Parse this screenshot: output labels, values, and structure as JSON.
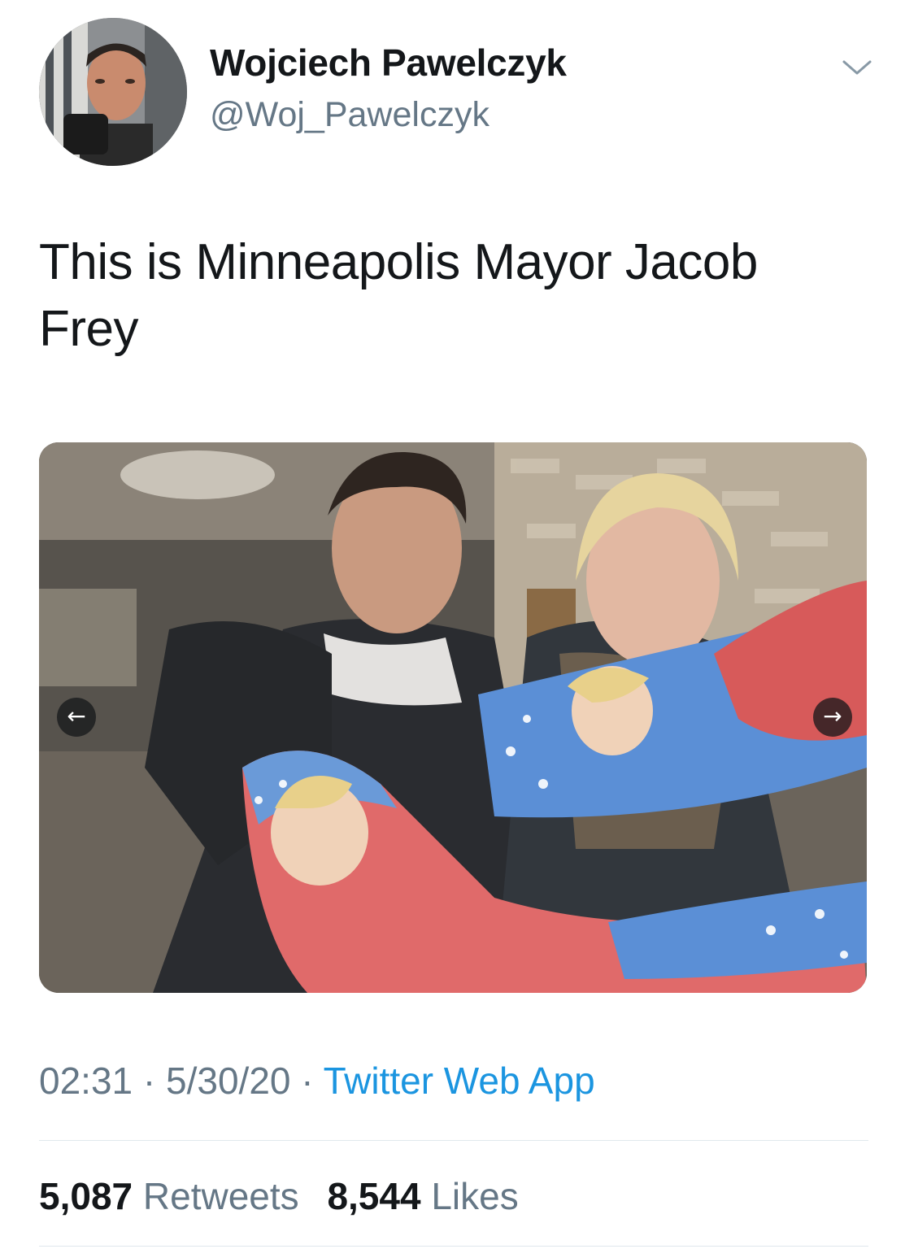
{
  "author": {
    "display_name": "Wojciech Pawelczyk",
    "handle": "@Woj_Pawelczyk",
    "avatar_icon": "profile-photo"
  },
  "menu": {
    "icon": "chevron-down-icon"
  },
  "tweet": {
    "text": "This is Minneapolis Mayor Jacob Frey"
  },
  "media": {
    "prev_icon": "←",
    "next_icon": "→"
  },
  "meta": {
    "time": "02:31",
    "separator": "·",
    "date": "5/30/20",
    "source": "Twitter Web App"
  },
  "stats": {
    "retweets_count": "5,087",
    "retweets_label": "Retweets",
    "likes_count": "8,544",
    "likes_label": "Likes"
  },
  "colors": {
    "text": "#14171a",
    "secondary": "#657786",
    "link": "#1b95e0",
    "divider": "#e1e8ed"
  }
}
